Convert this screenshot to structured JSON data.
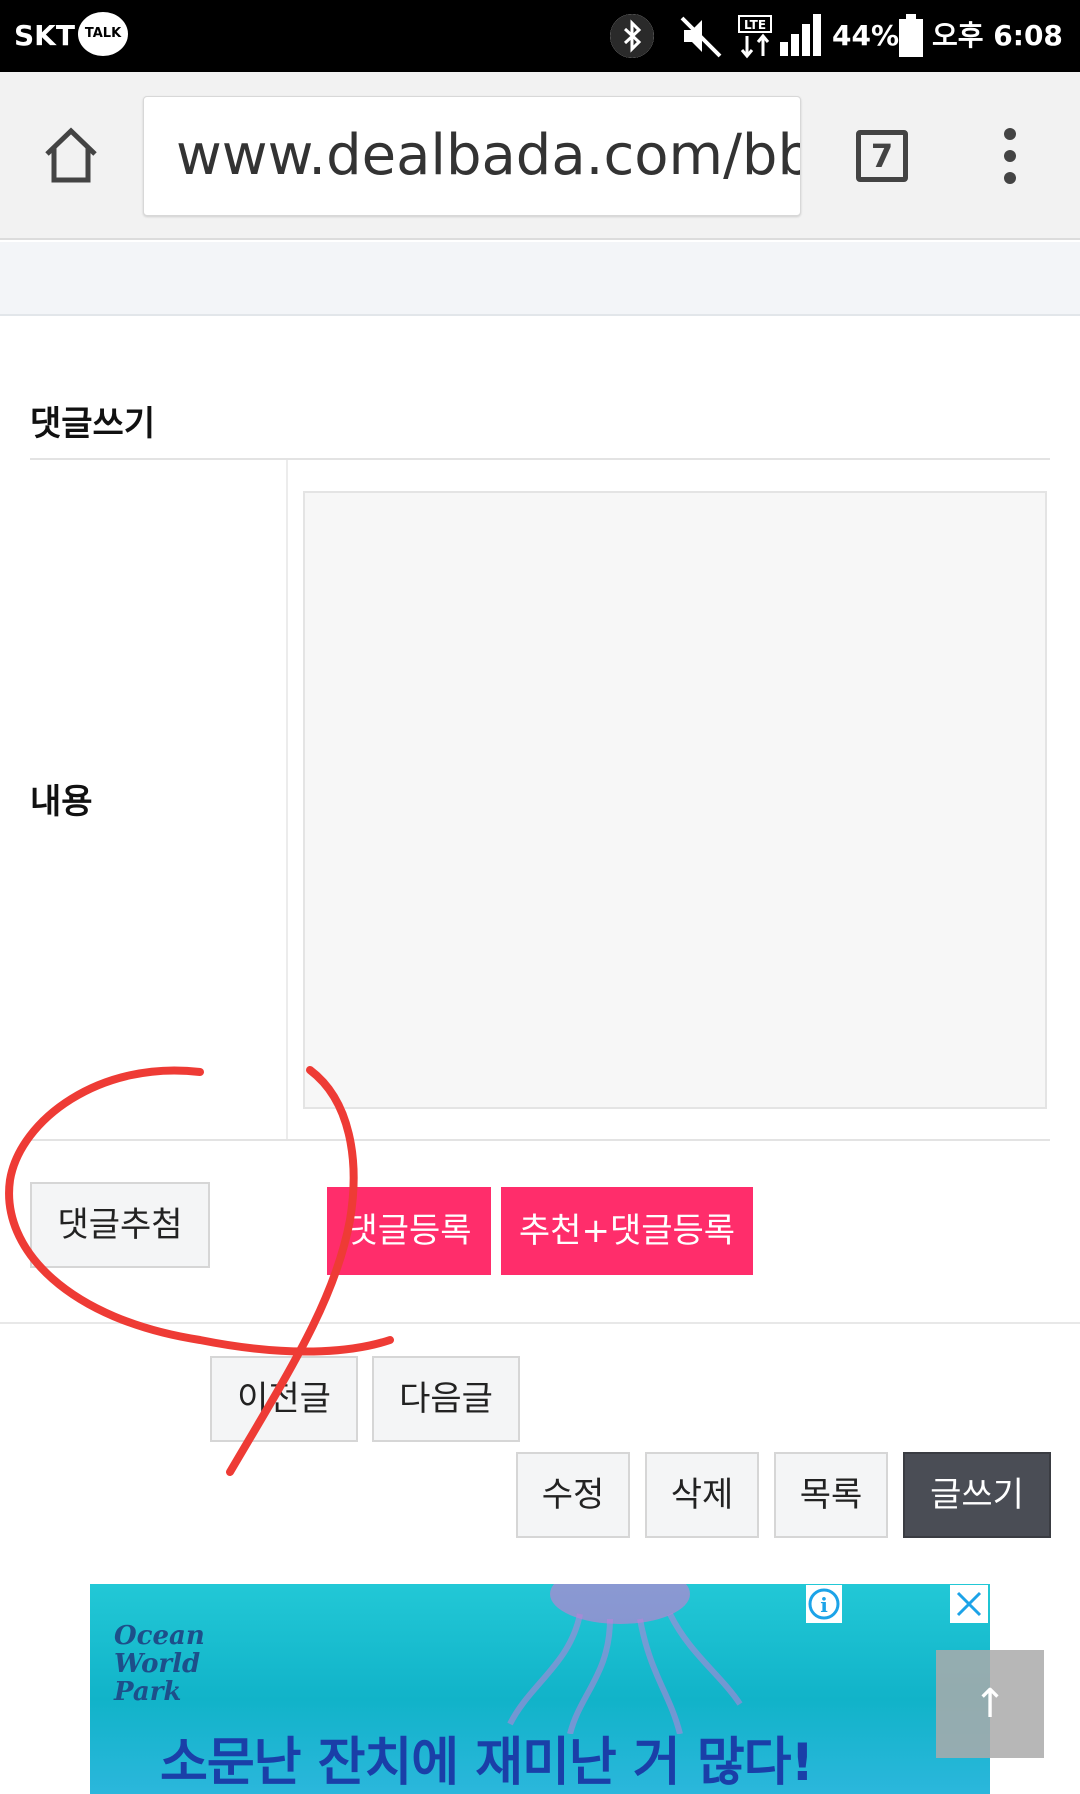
{
  "status_bar": {
    "carrier": "SKT",
    "talk_badge": "TALK",
    "battery": "44%",
    "time": "오후 6:08",
    "icons": [
      "talk-icon",
      "bluetooth-icon",
      "mute-icon",
      "lte-icon",
      "signal-icon",
      "battery-icon"
    ]
  },
  "browser": {
    "url": "www.dealbada.com/bbs",
    "tab_count": "7"
  },
  "comment_form": {
    "heading": "댓글쓰기",
    "content_label": "내용",
    "textarea_value": ""
  },
  "buttons": {
    "lottery": "댓글추첨",
    "register": "댓글등록",
    "recommend_register": "추천+댓글등록",
    "prev": "이전글",
    "next": "다음글",
    "edit": "수정",
    "delete": "삭제",
    "list": "목록",
    "write": "글쓰기"
  },
  "ad": {
    "logo": "Ocean World Park",
    "headline": "소문난 잔치에 재미난 거 많다!",
    "info_label": "i",
    "close_label": "✕"
  },
  "scroll_top_label": "↑",
  "colors": {
    "accent_pink": "#ff2d6b",
    "dark_button": "#4a4d55",
    "annotation_red": "#ee3b35"
  }
}
